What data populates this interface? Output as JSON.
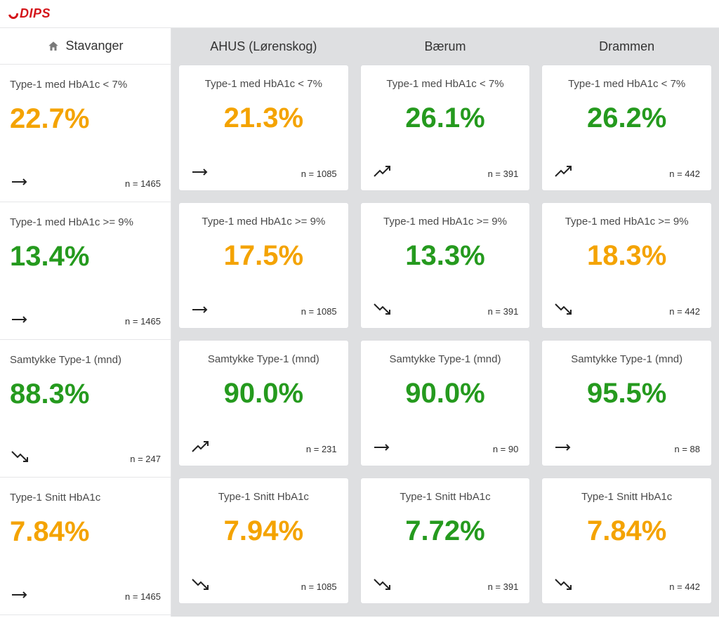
{
  "brand": "DIPS",
  "home_site": "Stavanger",
  "columns": [
    "AHUS (Lørenskog)",
    "Bærum",
    "Drammen"
  ],
  "metrics": [
    {
      "title": "Type-1 med HbA1c < 7%",
      "sb": {
        "value": "22.7%",
        "color": "orange",
        "trend": "flat",
        "n": "n = 1465"
      },
      "cells": [
        {
          "value": "21.3%",
          "color": "orange",
          "trend": "flat",
          "n": "n = 1085"
        },
        {
          "value": "26.1%",
          "color": "green",
          "trend": "up",
          "n": "n = 391"
        },
        {
          "value": "26.2%",
          "color": "green",
          "trend": "up",
          "n": "n = 442"
        }
      ]
    },
    {
      "title": "Type-1 med HbA1c >= 9%",
      "sb": {
        "value": "13.4%",
        "color": "green",
        "trend": "flat",
        "n": "n = 1465"
      },
      "cells": [
        {
          "value": "17.5%",
          "color": "orange",
          "trend": "flat",
          "n": "n = 1085"
        },
        {
          "value": "13.3%",
          "color": "green",
          "trend": "down",
          "n": "n = 391"
        },
        {
          "value": "18.3%",
          "color": "orange",
          "trend": "down",
          "n": "n = 442"
        }
      ]
    },
    {
      "title": "Samtykke Type-1 (mnd)",
      "sb": {
        "value": "88.3%",
        "color": "green",
        "trend": "down",
        "n": "n = 247"
      },
      "cells": [
        {
          "value": "90.0%",
          "color": "green",
          "trend": "up",
          "n": "n = 231"
        },
        {
          "value": "90.0%",
          "color": "green",
          "trend": "flat",
          "n": "n = 90"
        },
        {
          "value": "95.5%",
          "color": "green",
          "trend": "flat",
          "n": "n = 88"
        }
      ]
    },
    {
      "title": "Type-1 Snitt HbA1c",
      "sb": {
        "value": "7.84%",
        "color": "orange",
        "trend": "flat",
        "n": "n = 1465"
      },
      "cells": [
        {
          "value": "7.94%",
          "color": "orange",
          "trend": "down",
          "n": "n = 1085"
        },
        {
          "value": "7.72%",
          "color": "green",
          "trend": "down",
          "n": "n = 391"
        },
        {
          "value": "7.84%",
          "color": "orange",
          "trend": "down",
          "n": "n = 442"
        }
      ]
    }
  ],
  "chart_data": {
    "type": "table",
    "title": "HbA1c KPIs by site",
    "metrics": [
      "Type-1 med HbA1c < 7%",
      "Type-1 med HbA1c >= 9%",
      "Samtykke Type-1 (mnd)",
      "Type-1 Snitt HbA1c"
    ],
    "sites": [
      "Stavanger",
      "AHUS (Lørenskog)",
      "Bærum",
      "Drammen"
    ],
    "values_percent": [
      [
        22.7,
        21.3,
        26.1,
        26.2
      ],
      [
        13.4,
        17.5,
        13.3,
        18.3
      ],
      [
        88.3,
        90.0,
        90.0,
        95.5
      ],
      [
        7.84,
        7.94,
        7.72,
        7.84
      ]
    ],
    "n": [
      [
        1465,
        1085,
        391,
        442
      ],
      [
        1465,
        1085,
        391,
        442
      ],
      [
        247,
        231,
        90,
        88
      ],
      [
        1465,
        1085,
        391,
        442
      ]
    ],
    "trend": [
      [
        "flat",
        "flat",
        "up",
        "up"
      ],
      [
        "flat",
        "flat",
        "down",
        "down"
      ],
      [
        "down",
        "up",
        "flat",
        "flat"
      ],
      [
        "flat",
        "down",
        "down",
        "down"
      ]
    ],
    "color_threshold": [
      [
        "orange",
        "orange",
        "green",
        "green"
      ],
      [
        "green",
        "orange",
        "green",
        "orange"
      ],
      [
        "green",
        "green",
        "green",
        "green"
      ],
      [
        "orange",
        "orange",
        "green",
        "orange"
      ]
    ]
  }
}
